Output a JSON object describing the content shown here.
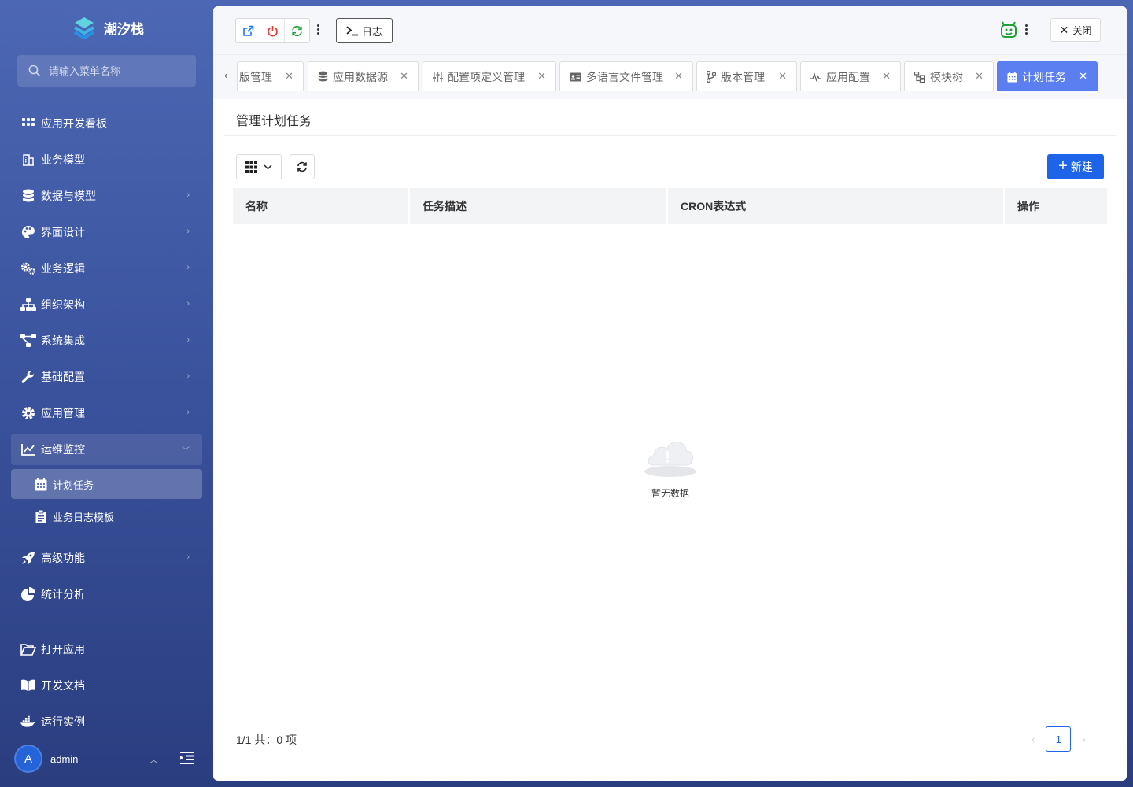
{
  "app": {
    "name": "潮汐栈"
  },
  "search": {
    "placeholder": "请输入菜单名称"
  },
  "sidebar": {
    "items": [
      {
        "label": "应用开发看板",
        "icon": "grid-icon",
        "chevron": false
      },
      {
        "label": "业务模型",
        "icon": "building-icon",
        "chevron": false
      },
      {
        "label": "数据与模型",
        "icon": "database-icon",
        "chevron": true
      },
      {
        "label": "界面设计",
        "icon": "palette-icon",
        "chevron": true
      },
      {
        "label": "业务逻辑",
        "icon": "cogs-icon",
        "chevron": true
      },
      {
        "label": "组织架构",
        "icon": "sitemap-icon",
        "chevron": true
      },
      {
        "label": "系统集成",
        "icon": "integration-icon",
        "chevron": true
      },
      {
        "label": "基础配置",
        "icon": "wrench-icon",
        "chevron": true
      },
      {
        "label": "应用管理",
        "icon": "gear-icon",
        "chevron": true
      },
      {
        "label": "运维监控",
        "icon": "chart-line-icon",
        "chevron": true,
        "expanded": true
      },
      {
        "label": "高级功能",
        "icon": "rocket-icon",
        "chevron": true
      },
      {
        "label": "统计分析",
        "icon": "pie-chart-icon",
        "chevron": false
      },
      {
        "label": "打开应用",
        "icon": "folder-open-icon",
        "chevron": false
      },
      {
        "label": "开发文档",
        "icon": "book-icon",
        "chevron": false
      },
      {
        "label": "运行实例",
        "icon": "docker-icon",
        "chevron": false
      }
    ],
    "subitems": [
      {
        "label": "计划任务",
        "icon": "calendar-icon",
        "active": true
      },
      {
        "label": "业务日志模板",
        "icon": "clipboard-icon",
        "active": false
      }
    ]
  },
  "user": {
    "avatar_letter": "A",
    "name": "admin"
  },
  "toolbar": {
    "log_label": "日志",
    "close_label": "关闭"
  },
  "tabs": [
    {
      "label": "版管理",
      "icon": "none"
    },
    {
      "label": "应用数据源",
      "icon": "database-icon"
    },
    {
      "label": "配置项定义管理",
      "icon": "sliders-icon"
    },
    {
      "label": "多语言文件管理",
      "icon": "id-card-icon"
    },
    {
      "label": "版本管理",
      "icon": "branch-icon"
    },
    {
      "label": "应用配置",
      "icon": "wave-icon"
    },
    {
      "label": "模块树",
      "icon": "tree-icon"
    },
    {
      "label": "计划任务",
      "icon": "calendar-icon",
      "active": true
    }
  ],
  "page": {
    "title": "管理计划任务",
    "new_label": "新建",
    "columns": [
      "名称",
      "任务描述",
      "CRON表达式",
      "操作"
    ],
    "empty_text": "暂无数据",
    "footer_count": "1/1 共：0 项",
    "current_page": "1"
  },
  "colors": {
    "accent": "#1d64e8",
    "active_tab": "#5b7ff0",
    "sidebar": "#3a529c"
  }
}
